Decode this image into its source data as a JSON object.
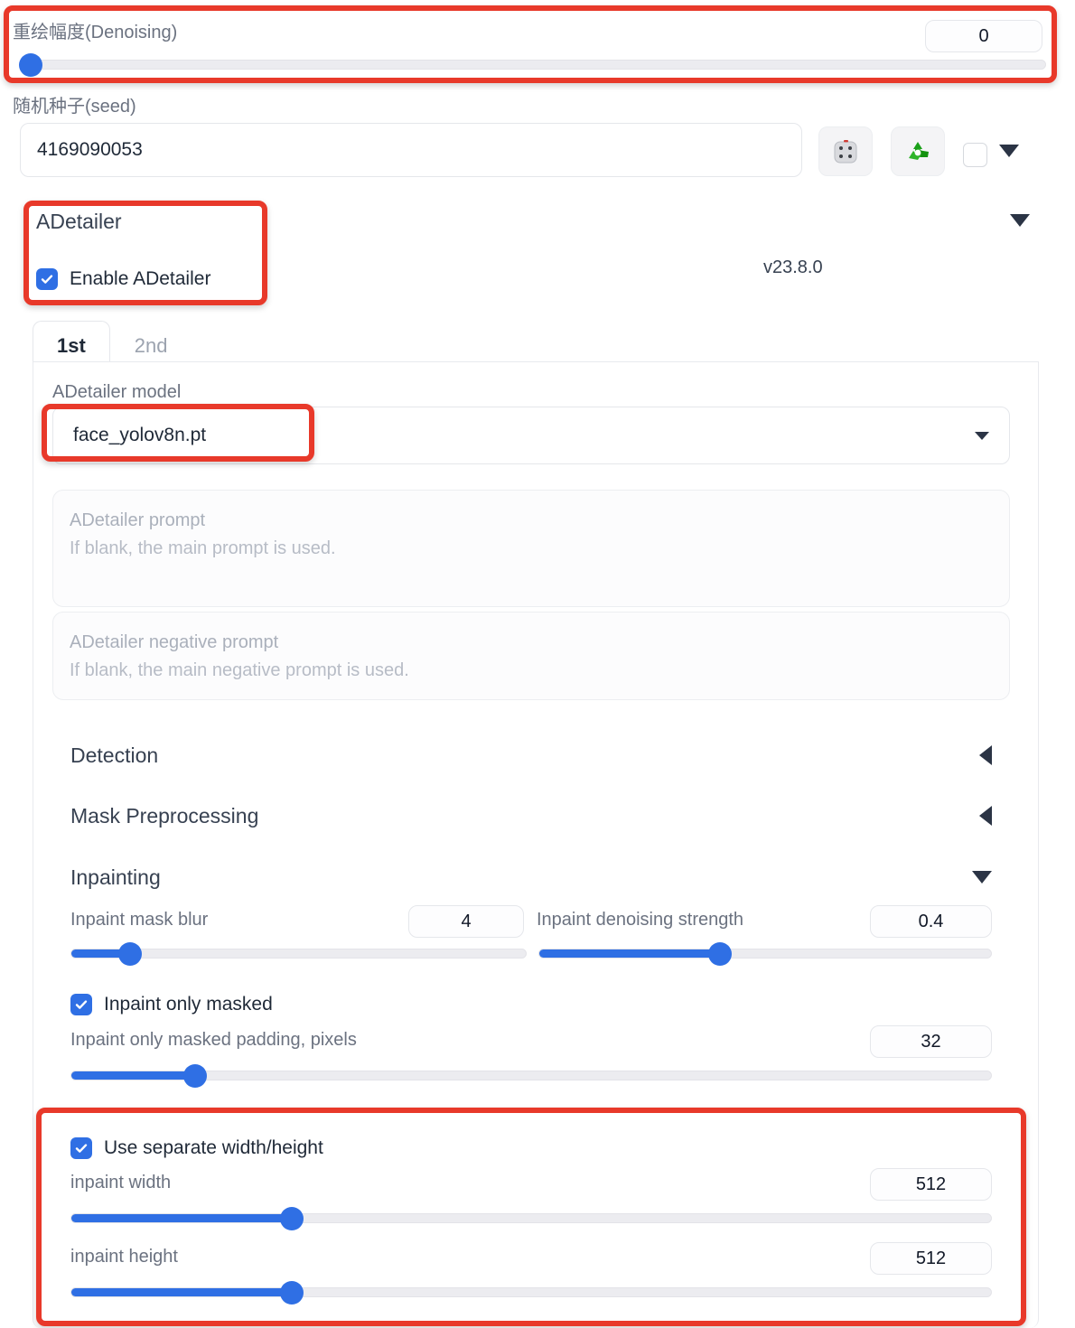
{
  "denoising": {
    "label": "重绘幅度(Denoising)",
    "value": "0",
    "slider_percent": 0
  },
  "seed": {
    "label": "随机种子(seed)",
    "value": "4169090053",
    "dice_icon": "dice-icon",
    "recycle_icon": "recycle-icon",
    "extra_checkbox": "",
    "caret_icon": "chevron-down-icon"
  },
  "adetailer": {
    "title": "ADetailer",
    "enable_label": "Enable ADetailer",
    "enabled": true,
    "version": "v23.8.0",
    "collapse_icon": "chevron-down-icon",
    "tabs": [
      {
        "label": "1st",
        "active": true
      },
      {
        "label": "2nd",
        "active": false
      }
    ],
    "model": {
      "label": "ADetailer model",
      "value": "face_yolov8n.pt",
      "caret_icon": "chevron-down-icon"
    },
    "prompt": {
      "placeholder_line1": "ADetailer prompt",
      "placeholder_line2": "If blank, the main prompt is used.",
      "value": ""
    },
    "negative_prompt": {
      "placeholder_line1": "ADetailer negative prompt",
      "placeholder_line2": "If blank, the main negative prompt is used.",
      "value": ""
    },
    "sections": [
      {
        "title": "Detection",
        "expanded": false,
        "icon": "chevron-left-icon"
      },
      {
        "title": "Mask Preprocessing",
        "expanded": false,
        "icon": "chevron-left-icon"
      },
      {
        "title": "Inpainting",
        "expanded": true,
        "icon": "chevron-down-icon"
      }
    ],
    "inpainting": {
      "mask_blur": {
        "label": "Inpaint mask blur",
        "value": "4",
        "slider_percent": 13
      },
      "denoising_strength": {
        "label": "Inpaint denoising strength",
        "value": "0.4",
        "slider_percent": 40
      },
      "only_masked": {
        "label": "Inpaint only masked",
        "checked": true
      },
      "only_masked_padding": {
        "label": "Inpaint only masked padding, pixels",
        "value": "32",
        "slider_percent": 13.5
      },
      "use_separate_wh": {
        "label": "Use separate width/height",
        "checked": true
      },
      "inpaint_width": {
        "label": "inpaint width",
        "value": "512",
        "slider_percent": 24
      },
      "inpaint_height": {
        "label": "inpaint height",
        "value": "512",
        "slider_percent": 24
      }
    }
  },
  "colors": {
    "accent_blue": "#2f6fe4",
    "annotation_red": "#e8392a",
    "label_gray": "#6b7280"
  }
}
